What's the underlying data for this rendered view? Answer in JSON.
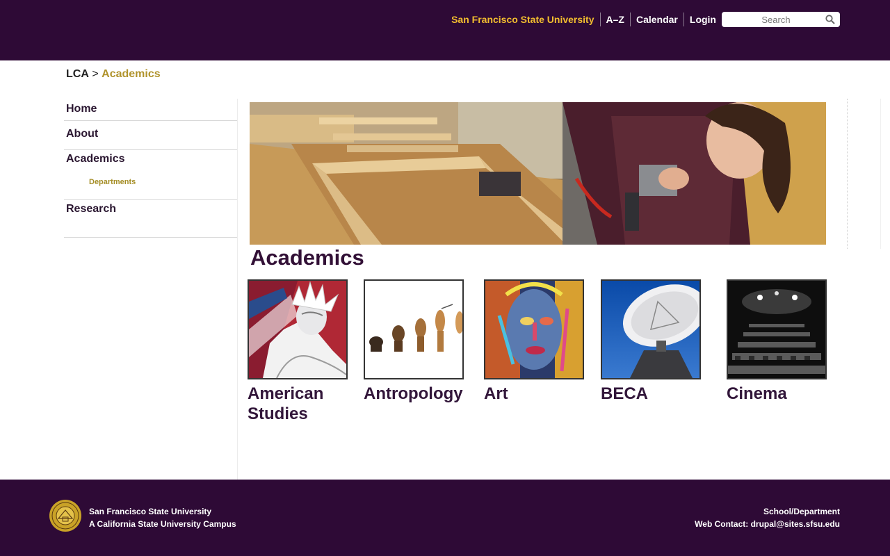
{
  "header": {
    "university_link": "San Francisco State University",
    "links": [
      "A–Z",
      "Calendar",
      "Login"
    ],
    "search_placeholder": "Search"
  },
  "breadcrumb": {
    "root": "LCA",
    "separator": ">",
    "current": "Academics"
  },
  "sidebar": {
    "items": [
      {
        "label": "Home"
      },
      {
        "label": "About"
      },
      {
        "label": "Academics",
        "subitems": [
          {
            "label": "Departments"
          }
        ]
      },
      {
        "label": "Research"
      }
    ]
  },
  "main": {
    "title": "Academics",
    "departments": [
      {
        "label": "American Studies",
        "icon": "statue-of-liberty-image"
      },
      {
        "label": "Antropology",
        "icon": "human-evolution-image"
      },
      {
        "label": "Art",
        "icon": "colorful-portrait-image"
      },
      {
        "label": "BECA",
        "icon": "satellite-dish-image"
      },
      {
        "label": "Cinema",
        "icon": "theater-seats-image"
      }
    ]
  },
  "footer": {
    "university": "San Francisco State University",
    "campus": "A California State University Campus",
    "school": "School/Department",
    "web_contact": "Web Contact: drupal@sites.sfsu.edu"
  },
  "colors": {
    "brand_purple": "#2e0a36",
    "gold": "#f2bd2f",
    "sub_gold": "#a58e27"
  }
}
